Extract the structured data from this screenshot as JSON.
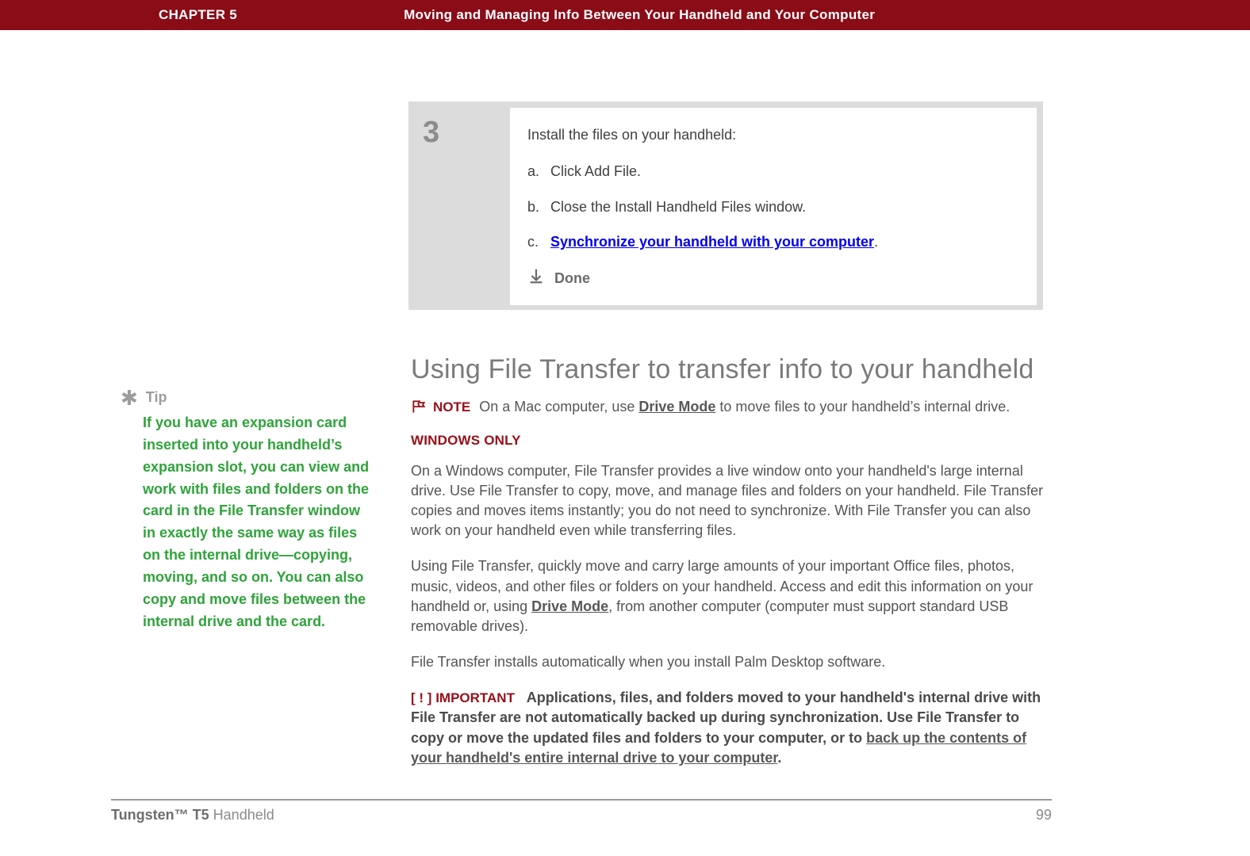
{
  "banner": {
    "chapter": "CHAPTER 5",
    "title": "Moving and Managing Info Between Your Handheld and Your Computer"
  },
  "step": {
    "number": "3",
    "lead": "Install the files on your handheld:",
    "items": {
      "a": {
        "letter": "a.",
        "text": "Click Add File."
      },
      "b": {
        "letter": "b.",
        "text": "Close the Install Handheld Files window."
      },
      "c": {
        "letter": "c.",
        "text": "Synchronize your handheld with your computer",
        "trail": "."
      }
    },
    "done": "Done"
  },
  "tip": {
    "icon": "✱",
    "label": "Tip",
    "body": "If you have an expansion card inserted into your handheld’s expansion slot, you can view and work with files and folders on the card in the File Transfer window in exactly the same way as files on the internal drive—copying, moving, and so on. You can also copy and move files between the internal drive and the card."
  },
  "main": {
    "heading": "Using File Transfer to transfer info to your handheld",
    "note": {
      "label": "NOTE",
      "before": "On a Mac computer, use ",
      "link": "Drive Mode",
      "after": " to move files to your handheld’s internal drive."
    },
    "windowsOnly": "WINDOWS ONLY",
    "p1": "On a Windows computer, File Transfer provides a live window onto your handheld's large internal drive. Use File Transfer to copy, move, and manage files and folders on your handheld. File Transfer copies and moves items instantly; you do not need to synchronize. With File Transfer you can also work on your handheld even while transferring files.",
    "p2": {
      "before": "Using File Transfer, quickly move and carry large amounts of your important Office files, photos, music, videos, and other files or folders on your handheld. Access and edit this information on your handheld or, using ",
      "link": "Drive Mode",
      "after": ", from another computer (computer must support standard USB removable drives)."
    },
    "p3": "File Transfer installs automatically when you install Palm Desktop software.",
    "important": {
      "tag": "IMPORTANT",
      "bracketL": "[ ",
      "bang": "!",
      "bracketR": " ]",
      "before": "Applications, files, and folders moved to your handheld's internal drive with File Transfer are not automatically backed up during synchronization. Use File Transfer to copy or move the updated files and folders to your computer, or to ",
      "link": "back up the contents of your handheld's entire internal drive to your computer",
      "after": "."
    }
  },
  "footer": {
    "productBold": "Tungsten™ T5",
    "productRest": " Handheld",
    "page": "99"
  },
  "colors": {
    "brandRed": "#8a0c17",
    "tipGreen": "#2fa33a",
    "grey": "#7a7a7a"
  }
}
